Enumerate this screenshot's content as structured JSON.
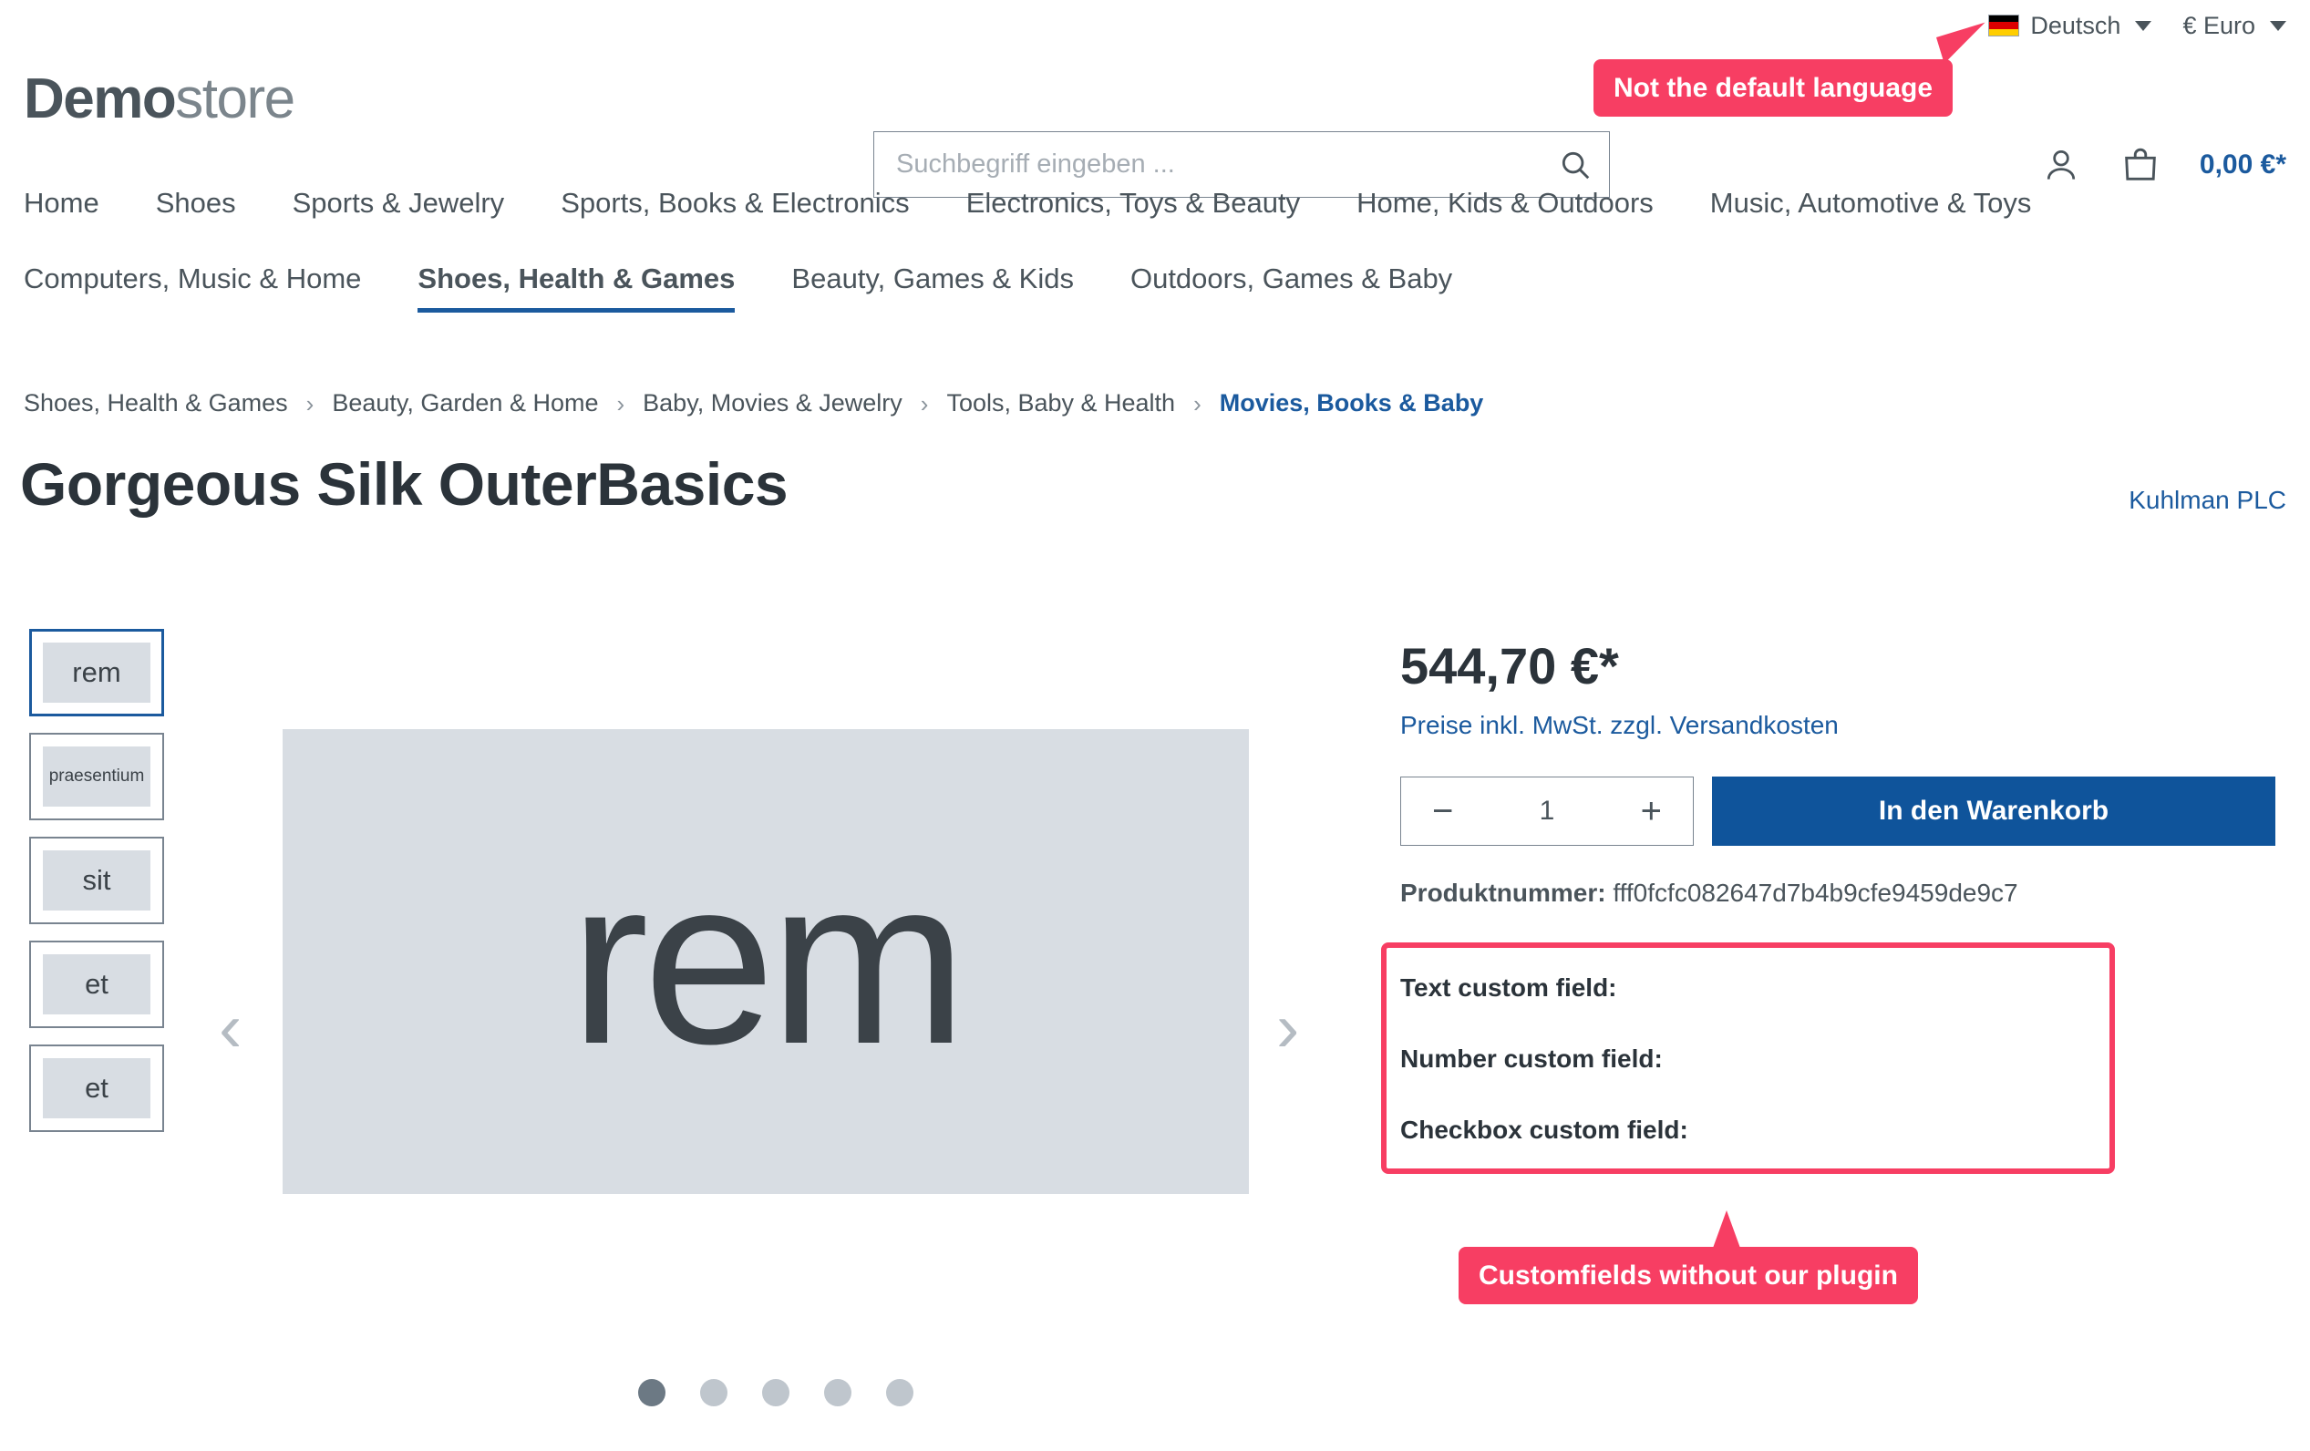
{
  "topbar": {
    "language": {
      "label": "Deutsch",
      "flag": "german-flag-icon"
    },
    "currency": {
      "label": "€ Euro"
    }
  },
  "header": {
    "logo_bold": "Demo",
    "logo_light": "store",
    "search": {
      "placeholder": "Suchbegriff eingeben ...",
      "value": ""
    },
    "account_icon": "user-icon",
    "cart_icon": "shopping-bag-icon",
    "cart_amount": "0,00 €*"
  },
  "nav": {
    "row1": [
      "Home",
      "Shoes",
      "Sports & Jewelry",
      "Sports, Books & Electronics",
      "Electronics, Toys & Beauty",
      "Home, Kids & Outdoors",
      "Music, Automotive & Toys"
    ],
    "row2": [
      "Computers, Music & Home",
      "Shoes, Health & Games",
      "Beauty, Games & Kids",
      "Outdoors, Games & Baby"
    ],
    "active_row2_index": 1
  },
  "breadcrumb": {
    "separator": "›",
    "items": [
      "Shoes, Health & Games",
      "Beauty, Garden & Home",
      "Baby, Movies & Jewelry",
      "Tools, Baby & Health",
      "Movies, Books & Baby"
    ]
  },
  "product": {
    "title": "Gorgeous Silk OuterBasics",
    "manufacturer": "Kuhlman PLC",
    "price": "544,70 €*",
    "tax_note": "Preise inkl. MwSt. zzgl. Versandkosten",
    "quantity": "1",
    "decrease_label": "−",
    "increase_label": "+",
    "add_to_cart_label": "In den Warenkorb",
    "product_number_label": "Produktnummer:",
    "product_number_value": "fff0fcfc082647d7b4b9cfe9459de9c7",
    "custom_fields": [
      {
        "label": "Text custom field:",
        "value": ""
      },
      {
        "label": "Number custom field:",
        "value": ""
      },
      {
        "label": "Checkbox custom field:",
        "value": ""
      }
    ]
  },
  "gallery": {
    "thumbnails": [
      {
        "text": "rem",
        "active": true
      },
      {
        "text": "praesentium",
        "active": false
      },
      {
        "text": "sit",
        "active": false
      },
      {
        "text": "et",
        "active": false
      },
      {
        "text": "et",
        "active": false
      }
    ],
    "main_image_text": "rem",
    "prev_arrow": "‹",
    "next_arrow": "›",
    "dot_count": 5,
    "active_dot": 0
  },
  "annotations": [
    {
      "id": "language",
      "text": "Not the default language"
    },
    {
      "id": "customfields",
      "text": "Customfields without our plugin"
    }
  ],
  "colors": {
    "accent_blue": "#1b5a9e",
    "button_blue": "#0f549b",
    "annotation_pink": "#f73e63",
    "text_dark": "#2b333a",
    "text_body": "#4a545b",
    "placeholder_gray": "#d8dde3"
  }
}
